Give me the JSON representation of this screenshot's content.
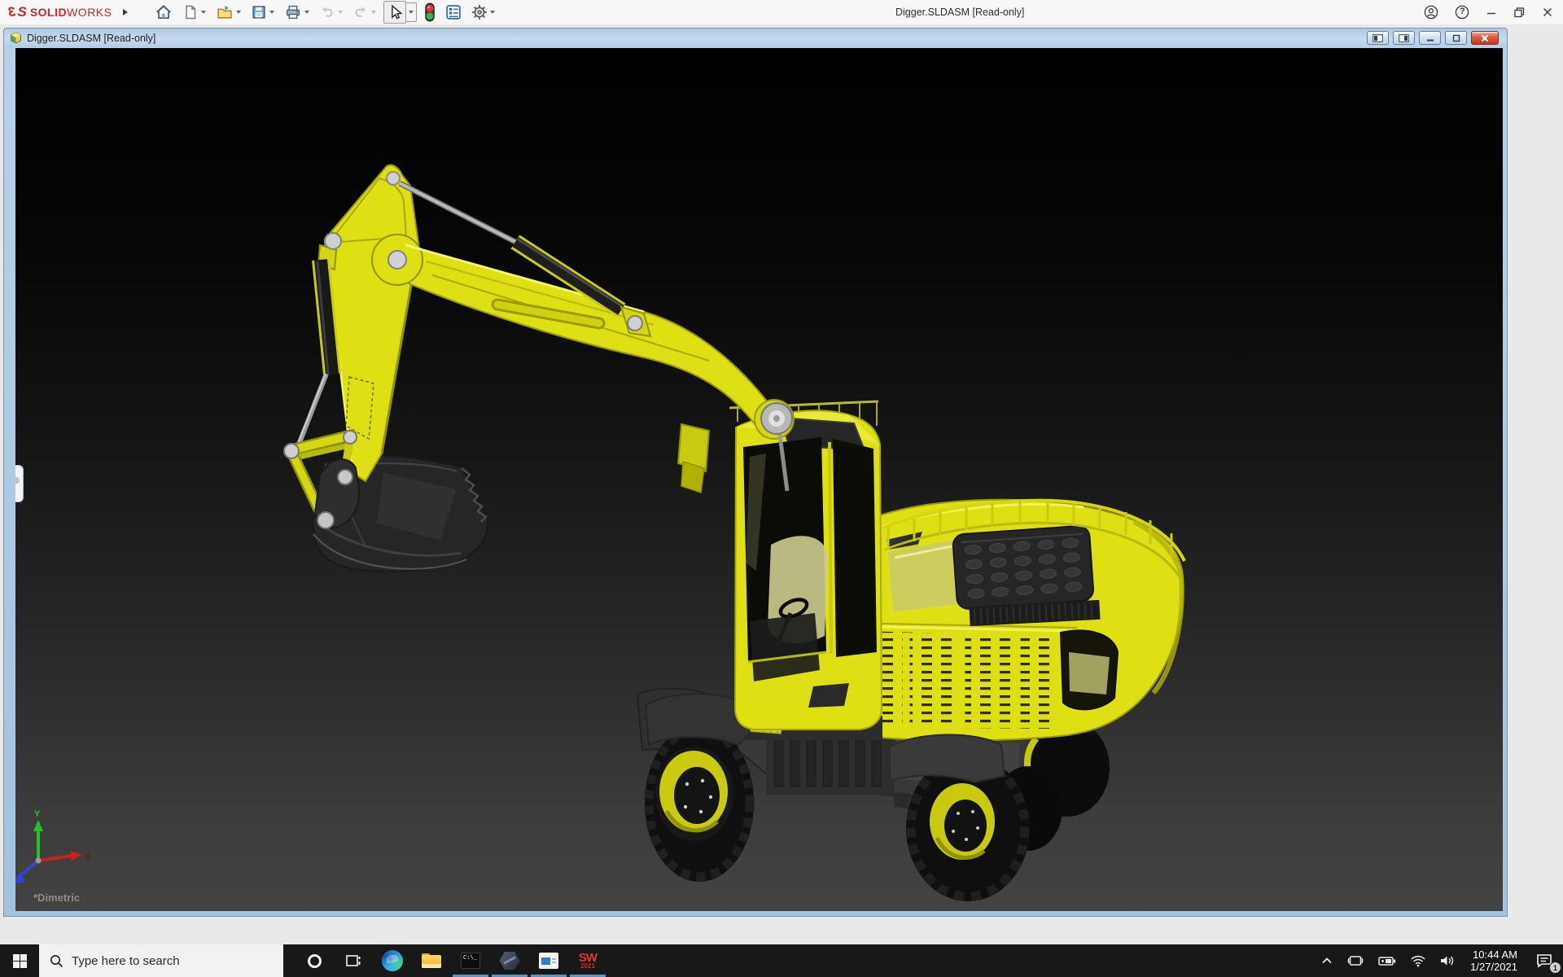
{
  "app_titlebar": {
    "logo": {
      "glyph": "3",
      "bold": "SOLID",
      "light": "WORKS",
      "color": "#d2232a"
    },
    "title": "Digger.SLDASM [Read-only]",
    "help_glyph": "?",
    "toolbar_icons": [
      "home",
      "new-document",
      "open",
      "save",
      "print",
      "undo",
      "redo",
      "select-cursor",
      "display-lights",
      "file-properties",
      "options-gear"
    ]
  },
  "document_window": {
    "title": "Digger.SLDASM [Read-only]",
    "window_buttons": [
      "pane-left",
      "pane-right",
      "minimize",
      "restore",
      "close"
    ]
  },
  "viewport": {
    "orientation_label": "*Dimetric",
    "model_name": "Digger excavator assembly",
    "triad": {
      "y_label": "Y",
      "x_label": "X",
      "x_color": "#cc2020",
      "y_color": "#25c125",
      "z_color": "#3344cc"
    },
    "colors": {
      "body_yellow": "#dfe013",
      "yellow_dark": "#a8a905",
      "dark_parts": "#2a2a2a",
      "pins": "#cfcfcf",
      "background_top": "#000000",
      "background_bottom": "#434343"
    }
  },
  "taskbar": {
    "search_placeholder": "Type here to search",
    "cmd_glyph": "C:\\_",
    "apps": [
      {
        "name": "edge",
        "running": false
      },
      {
        "name": "file-explorer",
        "running": false
      },
      {
        "name": "command-prompt",
        "running": true
      },
      {
        "name": "hexagon-app",
        "running": true
      },
      {
        "name": "window-app",
        "running": true
      },
      {
        "name": "solidworks-2021",
        "running": true
      }
    ],
    "solidworks": {
      "label": "SW",
      "year": "2021"
    },
    "tray": {
      "time": "10:44 AM",
      "date": "1/27/2021",
      "notification_count": "1"
    }
  }
}
